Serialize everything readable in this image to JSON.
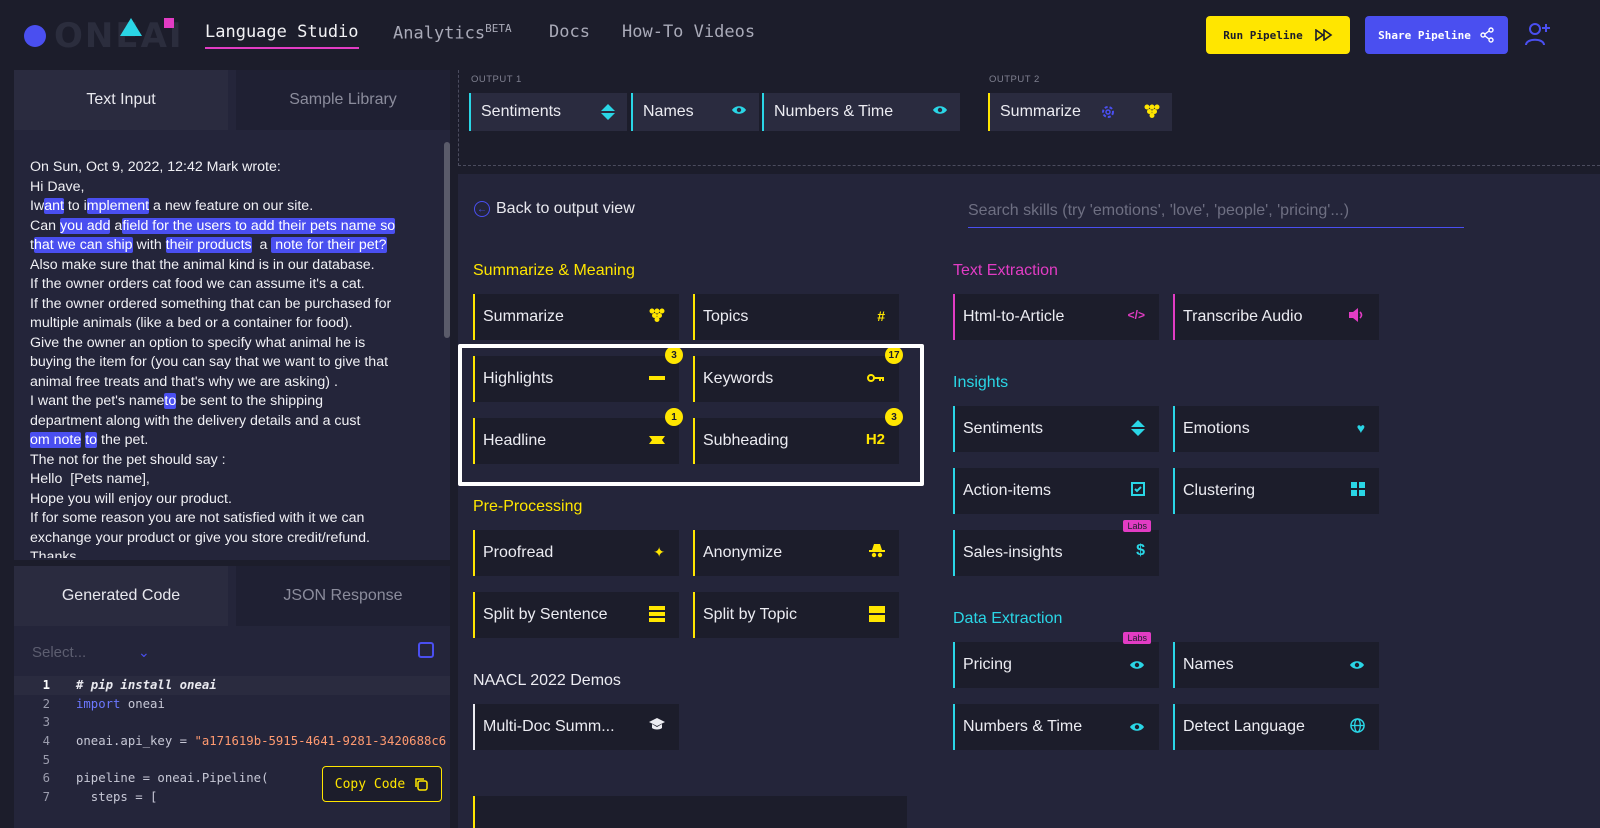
{
  "topnav": {
    "logo": "ONEAI",
    "items": [
      {
        "label": "Language Studio"
      },
      {
        "label": "Analytics",
        "sup": "BETA"
      },
      {
        "label": "Docs"
      },
      {
        "label": "How-To Videos"
      }
    ],
    "run_pipeline": "Run Pipeline",
    "share_pipeline": "Share Pipeline"
  },
  "input_panel": {
    "tabs": [
      "Text Input",
      "Sample Library"
    ],
    "text_lines": [
      "On Sun, Oct 9, 2022, 12:42 Mark wrote:",
      "Hi Dave,"
    ],
    "remaining_lines": [
      "Also make sure that the animal kind is in our database.",
      "If the owner orders cat food we can assume it's a cat.",
      "If the owner ordered something that can be purchased for",
      "multiple animals (like a bed or a container for food).",
      "Give the owner an option to specify what animal he is",
      "buying the item for (you can say that we want to give that",
      "animal free treats and that's why we are asking) ."
    ],
    "tail_lines": [
      "The not for the pet should say :",
      "Hello  [Pets name],",
      "Hope you will enjoy our product.",
      "If for some reason you are not satisfied with it we can",
      "exchange your product or give you store credit/refund.",
      "Thanks"
    ]
  },
  "code_panel": {
    "tabs": [
      "Generated Code",
      "JSON Response"
    ],
    "select_placeholder": "Select...",
    "copy_code": "Copy Code",
    "line_numbers": [
      "1",
      "2",
      "3",
      "4",
      "5",
      "6",
      "7"
    ],
    "line1": "# pip install oneai",
    "line2_kw": "import",
    "line2_rest": " oneai",
    "line4_a": "oneai.api_key = ",
    "line4_str": "\"a171619b-5915-4641-9281-3420688c6",
    "line6": "pipeline = oneai.Pipeline(",
    "line7": "  steps = ["
  },
  "pipeline": {
    "output1_label": "OUTPUT 1",
    "output2_label": "OUTPUT 2",
    "output1": [
      "Sentiments",
      "Names",
      "Numbers & Time"
    ],
    "output2": [
      "Summarize"
    ]
  },
  "skills_panel": {
    "back": "Back to output view",
    "search_placeholder": "Search skills (try 'emotions', 'love', 'people', 'pricing'...)",
    "summarize_meaning": {
      "title": "Summarize & Meaning",
      "skills": [
        "Summarize",
        "Topics",
        "Highlights",
        "Keywords",
        "Headline",
        "Subheading"
      ],
      "badges": {
        "highlights": "3",
        "keywords": "17",
        "headline": "1",
        "subheading": "3"
      }
    },
    "pre_processing": {
      "title": "Pre-Processing",
      "skills": [
        "Proofread",
        "Anonymize",
        "Split by Sentence",
        "Split by Topic"
      ]
    },
    "naacl": {
      "title": "NAACL 2022 Demos",
      "skills": [
        "Multi-Doc Summ..."
      ]
    },
    "text_extraction": {
      "title": "Text Extraction",
      "skills": [
        "Html-to-Article",
        "Transcribe Audio"
      ]
    },
    "insights": {
      "title": "Insights",
      "skills": [
        "Sentiments",
        "Emotions",
        "Action-items",
        "Clustering",
        "Sales-insights"
      ],
      "labs": "Labs"
    },
    "data_extraction": {
      "title": "Data Extraction",
      "skills": [
        "Pricing",
        "Names",
        "Numbers & Time",
        "Detect Language"
      ],
      "labs": "Labs"
    },
    "icon_h2": "H2",
    "icon_dollar": "$"
  },
  "colors": {
    "accent_blue": "#4a4ff0",
    "yellow": "#ffe600",
    "magenta": "#e23cc4",
    "cyan": "#2ad6e6",
    "background": "#1c1d2b"
  }
}
